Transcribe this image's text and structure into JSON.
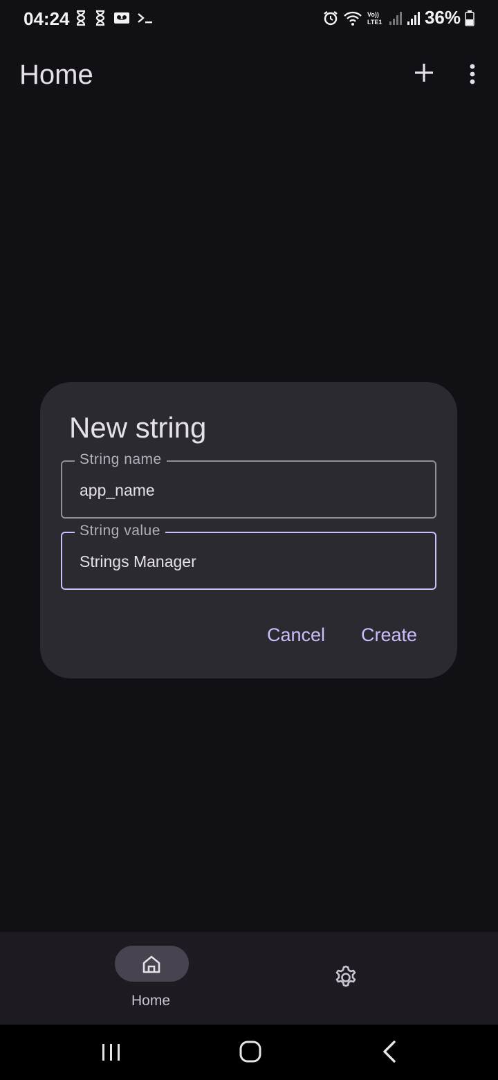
{
  "status_bar": {
    "time": "04:24",
    "battery": "36%",
    "left_icons": [
      "hourglass-icon",
      "hourglass-icon",
      "voicemail-icon",
      "terminal-icon"
    ],
    "right_icons": [
      "alarm-icon",
      "wifi-icon",
      "volte-icon",
      "signal-icon",
      "signal-icon",
      "battery-icon"
    ]
  },
  "app_bar": {
    "title": "Home",
    "actions": [
      "add-icon",
      "more-vert-icon"
    ]
  },
  "dialog": {
    "title": "New string",
    "fields": [
      {
        "label": "String name",
        "value": "app_name",
        "focused": false
      },
      {
        "label": "String value",
        "value": "Strings Manager",
        "focused": true
      }
    ],
    "cancel_label": "Cancel",
    "create_label": "Create"
  },
  "bottom_nav": {
    "items": [
      {
        "label": "Home",
        "icon": "home-icon",
        "selected": true
      },
      {
        "label": "",
        "icon": "settings-icon",
        "selected": false
      }
    ]
  },
  "colors": {
    "background": "#111014",
    "dialog_surface": "#2b2a30",
    "accent": "#cdbdfb",
    "nav_surface": "#1d1b21"
  }
}
